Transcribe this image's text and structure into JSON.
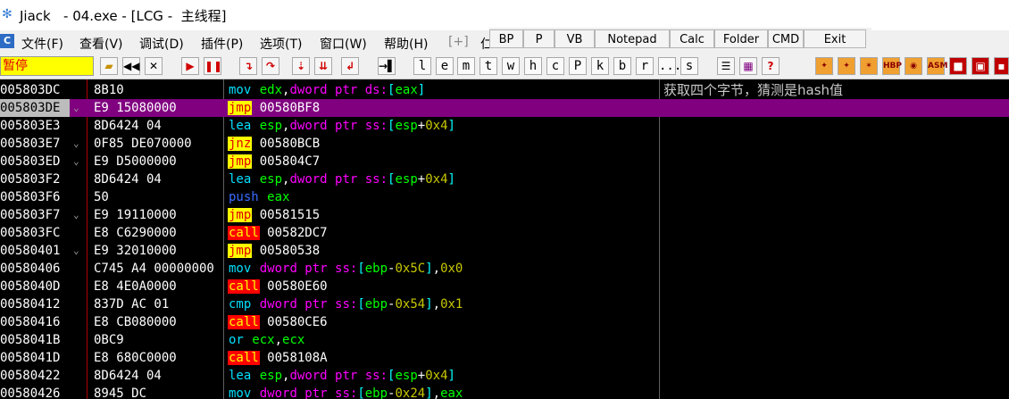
{
  "window": {
    "title": "Jiack   - 04.exe - [LCG -  主线程]"
  },
  "menu": {
    "items": [
      "文件(F)",
      "查看(V)",
      "调试(D)",
      "插件(P)",
      "选项(T)",
      "窗口(W)",
      "帮助(H)"
    ],
    "more": "[+]",
    "cut_item": "仁"
  },
  "plugin_toolbar": [
    "BP",
    "P",
    "VB",
    "Notepad",
    "Calc",
    "Folder",
    "CMD",
    "Exit"
  ],
  "toolbar": {
    "status": "暂停",
    "letter_buttons": [
      "l",
      "e",
      "m",
      "t",
      "w",
      "h",
      "c",
      "P",
      "k",
      "b",
      "r",
      "...",
      "s"
    ],
    "right_buttons": [
      "HBP",
      "ASM"
    ]
  },
  "disasm": {
    "rows": [
      {
        "addr": "005803DC",
        "hex": "8B10",
        "mnem": "mov",
        "ops": [
          [
            "reg",
            "edx"
          ],
          [
            "op",
            ","
          ],
          [
            "kw",
            "dword ptr ds:"
          ],
          [
            "brk",
            "["
          ],
          [
            "reg",
            "eax"
          ],
          [
            "brk",
            "]"
          ]
        ],
        "comment": "获取四个字节，猜测是hash值"
      },
      {
        "addr": "005803DE",
        "hex": "E9 15080000",
        "mnem": "jmp",
        "ops": [
          [
            "op",
            "00580BF8"
          ]
        ],
        "selected": true,
        "mark": "⌄"
      },
      {
        "addr": "005803E3",
        "hex": "8D6424 04",
        "mnem": "lea",
        "ops": [
          [
            "reg",
            "esp"
          ],
          [
            "op",
            ","
          ],
          [
            "kw",
            "dword ptr ss:"
          ],
          [
            "brk",
            "["
          ],
          [
            "reg",
            "esp"
          ],
          [
            "op",
            "+"
          ],
          [
            "num",
            "0x4"
          ],
          [
            "brk",
            "]"
          ]
        ]
      },
      {
        "addr": "005803E7",
        "hex": "0F85 DE070000",
        "mnem": "jnz",
        "ops": [
          [
            "op",
            "00580BCB"
          ]
        ],
        "mark": "⌄"
      },
      {
        "addr": "005803ED",
        "hex": "E9 D5000000",
        "mnem": "jmp",
        "ops": [
          [
            "op",
            "005804C7"
          ]
        ],
        "mark": "⌄"
      },
      {
        "addr": "005803F2",
        "hex": "8D6424 04",
        "mnem": "lea",
        "ops": [
          [
            "reg",
            "esp"
          ],
          [
            "op",
            ","
          ],
          [
            "kw",
            "dword ptr ss:"
          ],
          [
            "brk",
            "["
          ],
          [
            "reg",
            "esp"
          ],
          [
            "op",
            "+"
          ],
          [
            "num",
            "0x4"
          ],
          [
            "brk",
            "]"
          ]
        ]
      },
      {
        "addr": "005803F6",
        "hex": "50",
        "mnem": "push",
        "ops": [
          [
            "reg",
            "eax"
          ]
        ]
      },
      {
        "addr": "005803F7",
        "hex": "E9 19110000",
        "mnem": "jmp",
        "ops": [
          [
            "op",
            "00581515"
          ]
        ],
        "mark": "⌄"
      },
      {
        "addr": "005803FC",
        "hex": "E8 C6290000",
        "mnem": "call",
        "ops": [
          [
            "op",
            "00582DC7"
          ]
        ]
      },
      {
        "addr": "00580401",
        "hex": "E9 32010000",
        "mnem": "jmp",
        "ops": [
          [
            "op",
            "00580538"
          ]
        ],
        "mark": "⌄"
      },
      {
        "addr": "00580406",
        "hex": "C745 A4 00000000",
        "mnem": "mov",
        "ops": [
          [
            "kw",
            "dword ptr ss:"
          ],
          [
            "brk",
            "["
          ],
          [
            "reg",
            "ebp"
          ],
          [
            "op",
            "-"
          ],
          [
            "num",
            "0x5C"
          ],
          [
            "brk",
            "]"
          ],
          [
            "op",
            ","
          ],
          [
            "num",
            "0x0"
          ]
        ]
      },
      {
        "addr": "0058040D",
        "hex": "E8 4E0A0000",
        "mnem": "call",
        "ops": [
          [
            "op",
            "00580E60"
          ]
        ]
      },
      {
        "addr": "00580412",
        "hex": "837D AC 01",
        "mnem": "cmp",
        "ops": [
          [
            "kw",
            "dword ptr ss:"
          ],
          [
            "brk",
            "["
          ],
          [
            "reg",
            "ebp"
          ],
          [
            "op",
            "-"
          ],
          [
            "num",
            "0x54"
          ],
          [
            "brk",
            "]"
          ],
          [
            "op",
            ","
          ],
          [
            "num",
            "0x1"
          ]
        ]
      },
      {
        "addr": "00580416",
        "hex": "E8 CB080000",
        "mnem": "call",
        "ops": [
          [
            "op",
            "00580CE6"
          ]
        ]
      },
      {
        "addr": "0058041B",
        "hex": "0BC9",
        "mnem": "or",
        "ops": [
          [
            "reg",
            "ecx"
          ],
          [
            "op",
            ","
          ],
          [
            "reg",
            "ecx"
          ]
        ]
      },
      {
        "addr": "0058041D",
        "hex": "E8 680C0000",
        "mnem": "call",
        "ops": [
          [
            "op",
            "0058108A"
          ]
        ]
      },
      {
        "addr": "00580422",
        "hex": "8D6424 04",
        "mnem": "lea",
        "ops": [
          [
            "reg",
            "esp"
          ],
          [
            "op",
            ","
          ],
          [
            "kw",
            "dword ptr ss:"
          ],
          [
            "brk",
            "["
          ],
          [
            "reg",
            "esp"
          ],
          [
            "op",
            "+"
          ],
          [
            "num",
            "0x4"
          ],
          [
            "brk",
            "]"
          ]
        ]
      },
      {
        "addr": "00580426",
        "hex": "8945 DC",
        "mnem": "mov",
        "ops": [
          [
            "kw",
            "dword ptr ss:"
          ],
          [
            "brk",
            "["
          ],
          [
            "reg",
            "ebp"
          ],
          [
            "op",
            "-"
          ],
          [
            "num",
            "0x24"
          ],
          [
            "brk",
            "]"
          ],
          [
            "op",
            ","
          ],
          [
            "reg",
            "eax"
          ]
        ]
      }
    ]
  }
}
